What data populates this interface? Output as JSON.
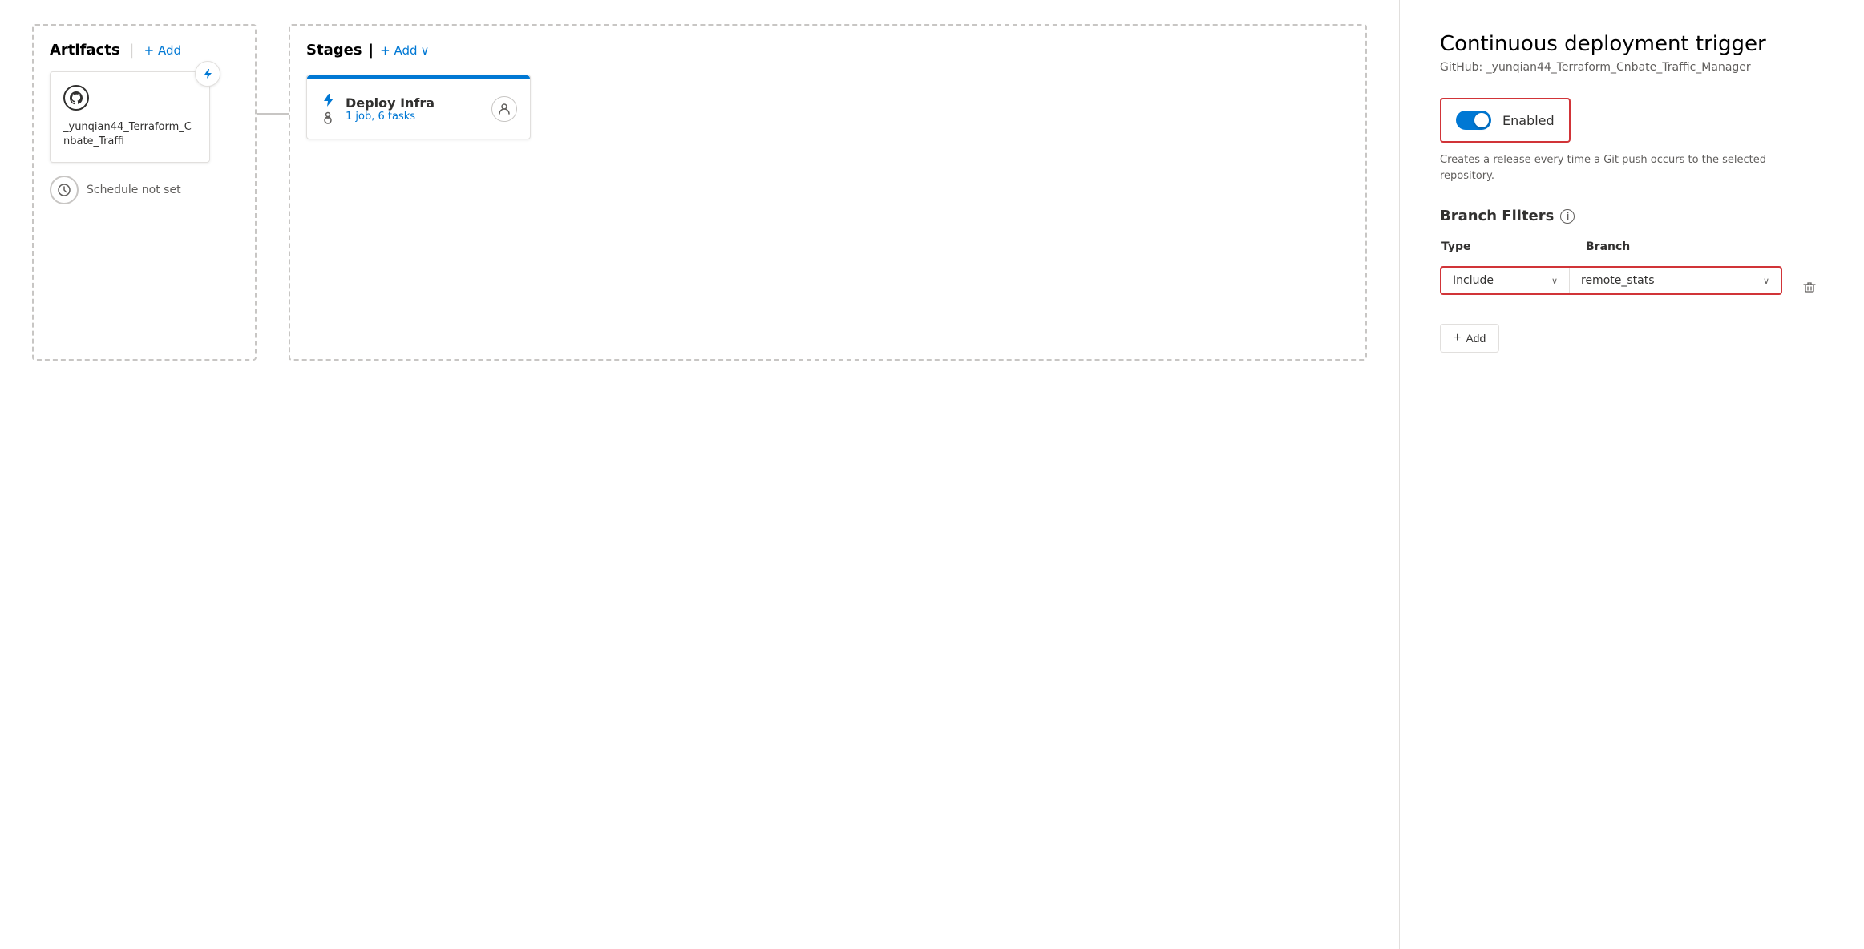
{
  "left": {
    "artifacts": {
      "title": "Artifacts",
      "add_label": "+ Add",
      "card": {
        "name": "_yunqian44_Terraform_Cnbate_Traffi",
        "github_icon": "⊙",
        "lightning_icon": "⚡"
      },
      "schedule": {
        "label": "Schedule not set"
      }
    },
    "stages": {
      "title": "Stages",
      "add_label": "+ Add",
      "add_chevron": "∨",
      "stage_card": {
        "name": "Deploy Infra",
        "tasks_label": "1 job, 6 tasks",
        "lightning_icon": "⚡",
        "user_icon": "👤"
      }
    }
  },
  "right": {
    "title": "Continuous deployment trigger",
    "subtitle": "GitHub: _yunqian44_Terraform_Cnbate_Traffic_Manager",
    "toggle": {
      "enabled": true,
      "label": "Enabled",
      "description": "Creates a release every time a Git push occurs to the selected repository."
    },
    "branch_filters": {
      "title": "Branch Filters",
      "info_label": "i",
      "columns": {
        "type_label": "Type",
        "branch_label": "Branch"
      },
      "filter": {
        "type_value": "Include",
        "branch_value": "remote_stats"
      },
      "add_label": "Add"
    }
  }
}
